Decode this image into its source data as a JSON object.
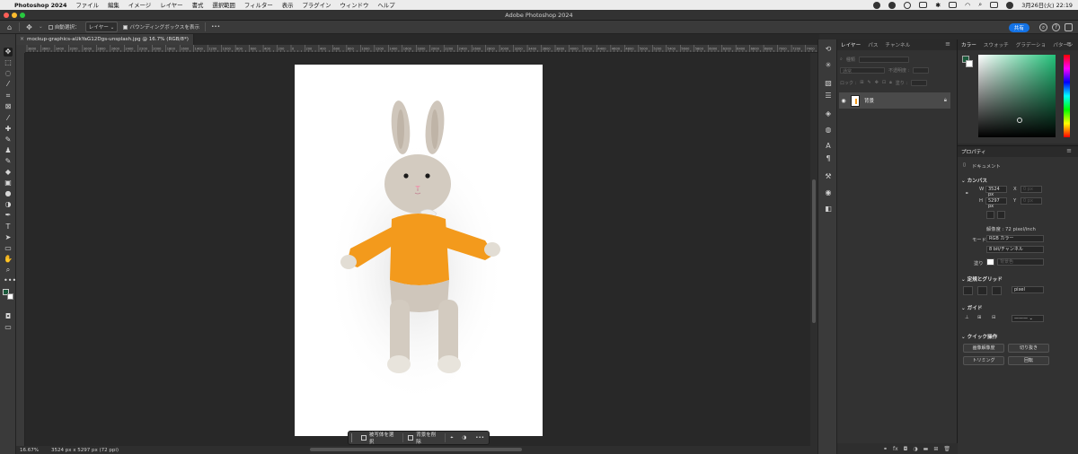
{
  "menubar": {
    "app": "Photoshop 2024",
    "items": [
      "ファイル",
      "編集",
      "イメージ",
      "レイヤー",
      "書式",
      "選択範囲",
      "フィルター",
      "表示",
      "プラグイン",
      "ウィンドウ",
      "ヘルプ"
    ],
    "datetime": "3月26日(火)  22:19"
  },
  "titlebar": {
    "title": "Adobe Photoshop 2024"
  },
  "options": {
    "auto_select": "自動選択：",
    "target": "レイヤー ⌄",
    "bounding": "バウンディングボックスを表示",
    "more": "•••",
    "share": "共有"
  },
  "document": {
    "tab": "mockup-graphics-aUkYaG12Dgs-unsplash.jpg @ 16.7% (RGB/8*)",
    "zoom": "16.67%",
    "size": "3524 px x 5297 px (72 ppi)"
  },
  "ruler": {
    "labels": [
      "3800",
      "3600",
      "3400",
      "3200",
      "3000",
      "2800",
      "2600",
      "2400",
      "2200",
      "2000",
      "1800",
      "1600",
      "1400",
      "1200",
      "1000",
      "800",
      "600",
      "400",
      "200",
      "0",
      "200",
      "400",
      "600",
      "800",
      "1000",
      "1200",
      "1400",
      "1600",
      "1800",
      "2000",
      "2200",
      "2400",
      "2600",
      "2800",
      "3000",
      "3200",
      "3400",
      "3600",
      "3800",
      "4000",
      "4200",
      "4400",
      "4600",
      "4800",
      "5000",
      "5200",
      "5400",
      "5600",
      "5800",
      "6000",
      "6200",
      "6400",
      "6600",
      "6800",
      "7000",
      "7200",
      "7400"
    ]
  },
  "taskbar": {
    "select_subject": "被写体を選択",
    "remove_bg": "背景を削除",
    "more": "•••"
  },
  "layers": {
    "tabs": [
      "レイヤー",
      "パス",
      "チャンネル"
    ],
    "kind": "種類",
    "mode": "通常",
    "opacity_label": "不透明度 :",
    "lock_label": "ロック :",
    "fill_label": "塗り :",
    "layer_name": "背景"
  },
  "color": {
    "tabs": [
      "カラー",
      "スウォッチ",
      "グラデーショ",
      "パターン"
    ],
    "fg": "#1c5a3c",
    "bg": "#ffffff"
  },
  "properties": {
    "tab": "プロパティ",
    "doc": "ドキュメント",
    "canvas": "カンバス",
    "w_label": "W",
    "w_value": "3524 px",
    "h_label": "H",
    "h_value": "5297 px",
    "x_label": "X",
    "y_label": "Y",
    "x_value": "0 px",
    "y_value": "0 px",
    "resolution": "解像度 : 72 pixel/inch",
    "mode_label": "モード",
    "mode_value": "RGB カラー",
    "bits_value": "8 bit/チャンネル",
    "fill_label": "塗り",
    "fill_value": "背景色",
    "rulers_grid": "定規とグリッド",
    "unit": "pixel",
    "guides": "ガイド",
    "quick": "クイック操作",
    "btn_resize": "画像解像度",
    "btn_crop": "切り抜き",
    "btn_trim": "トリミング",
    "btn_rotate": "回転"
  }
}
